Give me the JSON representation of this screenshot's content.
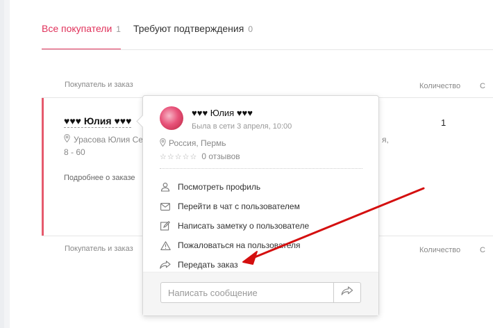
{
  "tabs": [
    {
      "label": "Все покупатели",
      "count": "1",
      "active": true
    },
    {
      "label": "Требуют подтверждения",
      "count": "0",
      "active": false
    }
  ],
  "table": {
    "col_buyer": "Покупатель и заказ",
    "col_qty": "Количество",
    "col_cut": "С"
  },
  "order": {
    "buyer_name": "♥♥♥ Юлия ♥♥♥",
    "address_line1": "Урасова Юлия Се",
    "address_tail": "я,",
    "address_line2": "8 - 60",
    "more_link": "Подробнее о заказе",
    "quantity": "1"
  },
  "popup": {
    "name": "♥♥♥ Юлия ♥♥♥",
    "last_seen": "Была в сети 3 апреля, 10:00",
    "location": "Россия, Пермь",
    "reviews": "0 отзывов",
    "stars": "☆☆☆☆☆",
    "menu": [
      {
        "label": "Посмотреть профиль",
        "icon": "user-icon"
      },
      {
        "label": "Перейти в чат с пользователем",
        "icon": "envelope-icon"
      },
      {
        "label": "Написать заметку о пользователе",
        "icon": "edit-icon"
      },
      {
        "label": "Пожаловаться на пользователя",
        "icon": "warning-icon"
      },
      {
        "label": "Передать заказ",
        "icon": "forward-icon"
      }
    ],
    "message_placeholder": "Написать сообщение"
  },
  "colors": {
    "accent": "#e0315a",
    "annotation_arrow": "#d40f0f"
  }
}
